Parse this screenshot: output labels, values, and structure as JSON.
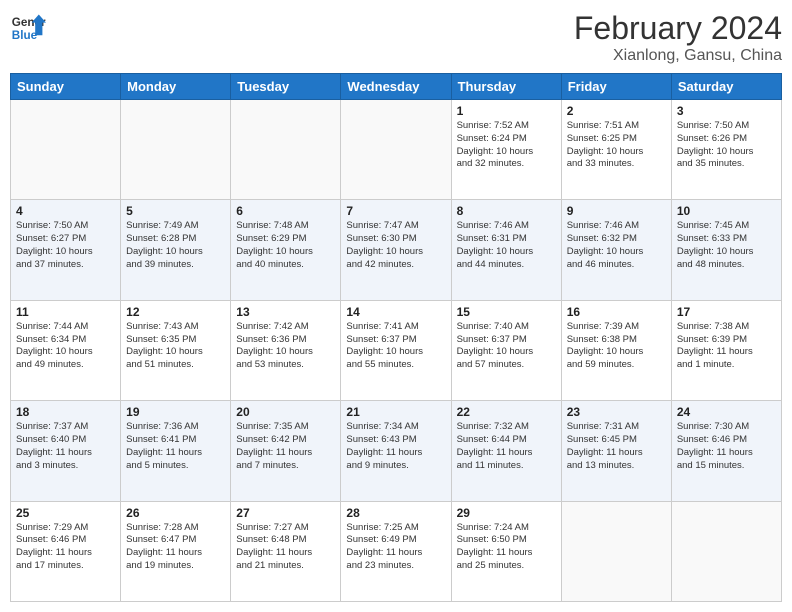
{
  "header": {
    "logo_general": "General",
    "logo_blue": "Blue",
    "main_title": "February 2024",
    "sub_title": "Xianlong, Gansu, China"
  },
  "days_of_week": [
    "Sunday",
    "Monday",
    "Tuesday",
    "Wednesday",
    "Thursday",
    "Friday",
    "Saturday"
  ],
  "weeks": [
    [
      {
        "day": "",
        "info": ""
      },
      {
        "day": "",
        "info": ""
      },
      {
        "day": "",
        "info": ""
      },
      {
        "day": "",
        "info": ""
      },
      {
        "day": "1",
        "info": "Sunrise: 7:52 AM\nSunset: 6:24 PM\nDaylight: 10 hours\nand 32 minutes."
      },
      {
        "day": "2",
        "info": "Sunrise: 7:51 AM\nSunset: 6:25 PM\nDaylight: 10 hours\nand 33 minutes."
      },
      {
        "day": "3",
        "info": "Sunrise: 7:50 AM\nSunset: 6:26 PM\nDaylight: 10 hours\nand 35 minutes."
      }
    ],
    [
      {
        "day": "4",
        "info": "Sunrise: 7:50 AM\nSunset: 6:27 PM\nDaylight: 10 hours\nand 37 minutes."
      },
      {
        "day": "5",
        "info": "Sunrise: 7:49 AM\nSunset: 6:28 PM\nDaylight: 10 hours\nand 39 minutes."
      },
      {
        "day": "6",
        "info": "Sunrise: 7:48 AM\nSunset: 6:29 PM\nDaylight: 10 hours\nand 40 minutes."
      },
      {
        "day": "7",
        "info": "Sunrise: 7:47 AM\nSunset: 6:30 PM\nDaylight: 10 hours\nand 42 minutes."
      },
      {
        "day": "8",
        "info": "Sunrise: 7:46 AM\nSunset: 6:31 PM\nDaylight: 10 hours\nand 44 minutes."
      },
      {
        "day": "9",
        "info": "Sunrise: 7:46 AM\nSunset: 6:32 PM\nDaylight: 10 hours\nand 46 minutes."
      },
      {
        "day": "10",
        "info": "Sunrise: 7:45 AM\nSunset: 6:33 PM\nDaylight: 10 hours\nand 48 minutes."
      }
    ],
    [
      {
        "day": "11",
        "info": "Sunrise: 7:44 AM\nSunset: 6:34 PM\nDaylight: 10 hours\nand 49 minutes."
      },
      {
        "day": "12",
        "info": "Sunrise: 7:43 AM\nSunset: 6:35 PM\nDaylight: 10 hours\nand 51 minutes."
      },
      {
        "day": "13",
        "info": "Sunrise: 7:42 AM\nSunset: 6:36 PM\nDaylight: 10 hours\nand 53 minutes."
      },
      {
        "day": "14",
        "info": "Sunrise: 7:41 AM\nSunset: 6:37 PM\nDaylight: 10 hours\nand 55 minutes."
      },
      {
        "day": "15",
        "info": "Sunrise: 7:40 AM\nSunset: 6:37 PM\nDaylight: 10 hours\nand 57 minutes."
      },
      {
        "day": "16",
        "info": "Sunrise: 7:39 AM\nSunset: 6:38 PM\nDaylight: 10 hours\nand 59 minutes."
      },
      {
        "day": "17",
        "info": "Sunrise: 7:38 AM\nSunset: 6:39 PM\nDaylight: 11 hours\nand 1 minute."
      }
    ],
    [
      {
        "day": "18",
        "info": "Sunrise: 7:37 AM\nSunset: 6:40 PM\nDaylight: 11 hours\nand 3 minutes."
      },
      {
        "day": "19",
        "info": "Sunrise: 7:36 AM\nSunset: 6:41 PM\nDaylight: 11 hours\nand 5 minutes."
      },
      {
        "day": "20",
        "info": "Sunrise: 7:35 AM\nSunset: 6:42 PM\nDaylight: 11 hours\nand 7 minutes."
      },
      {
        "day": "21",
        "info": "Sunrise: 7:34 AM\nSunset: 6:43 PM\nDaylight: 11 hours\nand 9 minutes."
      },
      {
        "day": "22",
        "info": "Sunrise: 7:32 AM\nSunset: 6:44 PM\nDaylight: 11 hours\nand 11 minutes."
      },
      {
        "day": "23",
        "info": "Sunrise: 7:31 AM\nSunset: 6:45 PM\nDaylight: 11 hours\nand 13 minutes."
      },
      {
        "day": "24",
        "info": "Sunrise: 7:30 AM\nSunset: 6:46 PM\nDaylight: 11 hours\nand 15 minutes."
      }
    ],
    [
      {
        "day": "25",
        "info": "Sunrise: 7:29 AM\nSunset: 6:46 PM\nDaylight: 11 hours\nand 17 minutes."
      },
      {
        "day": "26",
        "info": "Sunrise: 7:28 AM\nSunset: 6:47 PM\nDaylight: 11 hours\nand 19 minutes."
      },
      {
        "day": "27",
        "info": "Sunrise: 7:27 AM\nSunset: 6:48 PM\nDaylight: 11 hours\nand 21 minutes."
      },
      {
        "day": "28",
        "info": "Sunrise: 7:25 AM\nSunset: 6:49 PM\nDaylight: 11 hours\nand 23 minutes."
      },
      {
        "day": "29",
        "info": "Sunrise: 7:24 AM\nSunset: 6:50 PM\nDaylight: 11 hours\nand 25 minutes."
      },
      {
        "day": "",
        "info": ""
      },
      {
        "day": "",
        "info": ""
      }
    ]
  ]
}
